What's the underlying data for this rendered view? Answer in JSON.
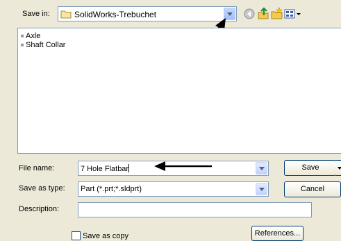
{
  "save_in": {
    "label": "Save in:",
    "folder": "SolidWorks-Trebuchet"
  },
  "toolbar": {
    "icons": [
      "back-icon",
      "up-folder-icon",
      "new-folder-icon",
      "views-menu-icon"
    ]
  },
  "files": [
    {
      "name": "Axle"
    },
    {
      "name": "Shaft Collar"
    }
  ],
  "fields": {
    "file_name_label": "File name:",
    "file_name_value": "7 Hole Flatbar",
    "save_as_type_label": "Save as type:",
    "save_as_type_value": "Part (*.prt;*.sldprt)",
    "description_label": "Description:",
    "description_value": ""
  },
  "buttons": {
    "save": "Save",
    "cancel": "Cancel",
    "references": "References..."
  },
  "save_as_copy_label": "Save as copy"
}
